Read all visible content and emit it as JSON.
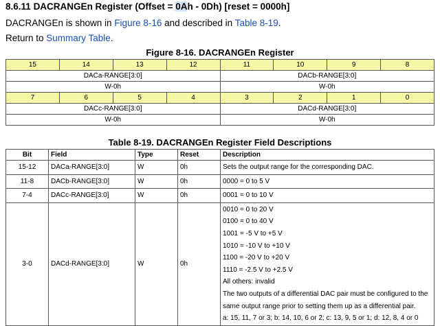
{
  "section": {
    "number": "8.6.11",
    "title_pre": "DACRANGEn Register (Offset = ",
    "title_highlight": "0A",
    "title_post": "h - 0Dh) [reset = 0000h]"
  },
  "intro": {
    "pre": "DACRANGEn is shown in ",
    "figure_link": "Figure 8-16",
    "mid": " and described in ",
    "table_link": "Table 8-19",
    "post": "."
  },
  "return": {
    "pre": "Return to ",
    "link": "Summary Table",
    "post": "."
  },
  "figure": {
    "title": "Figure 8-16. DACRANGEn Register",
    "upper_bits": [
      "15",
      "14",
      "13",
      "12",
      "11",
      "10",
      "9",
      "8"
    ],
    "upper_fields": [
      {
        "name": "DACa-RANGE[3:0]",
        "access": "W-0h"
      },
      {
        "name": "DACb-RANGE[3:0]",
        "access": "W-0h"
      }
    ],
    "lower_bits": [
      "7",
      "6",
      "5",
      "4",
      "3",
      "2",
      "1",
      "0"
    ],
    "lower_fields": [
      {
        "name": "DACc-RANGE[3:0]",
        "access": "W-0h"
      },
      {
        "name": "DACd-RANGE[3:0]",
        "access": "W-0h"
      }
    ]
  },
  "field_table": {
    "title": "Table 8-19. DACRANGEn Register Field Descriptions",
    "headers": [
      "Bit",
      "Field",
      "Type",
      "Reset",
      "Description"
    ],
    "rows": [
      {
        "bit": "15-12",
        "field": "DACa-RANGE[3:0]",
        "type": "W",
        "reset": "0h",
        "description": [
          "Sets the output range for the corresponding DAC."
        ]
      },
      {
        "bit": "11-8",
        "field": "DACb-RANGE[3:0]",
        "type": "W",
        "reset": "0h",
        "description": [
          "0000 = 0 to 5 V"
        ]
      },
      {
        "bit": "7-4",
        "field": "DACc-RANGE[3:0]",
        "type": "W",
        "reset": "0h",
        "description": [
          "0001 = 0 to 10 V"
        ]
      },
      {
        "bit": "3-0",
        "field": "DACd-RANGE[3:0]",
        "type": "W",
        "reset": "0h",
        "description": [
          "0010 = 0 to 20 V",
          "0100 = 0 to 40 V",
          "1001 = -5 V to +5 V",
          "1010 = -10 V to +10 V",
          "1100 = -20 V to +20 V",
          "1110 = -2.5 V to +2.5 V",
          "All others: invalid",
          "The two outputs of a differential DAC pair must be configured to the",
          "same output range prior to setting them up as a differential pair.",
          "a: 15, 11, 7 or 3; b: 14, 10, 6 or 2; c: 13, 9, 5 or 1; d: 12, 8, 4 or 0"
        ]
      }
    ]
  }
}
